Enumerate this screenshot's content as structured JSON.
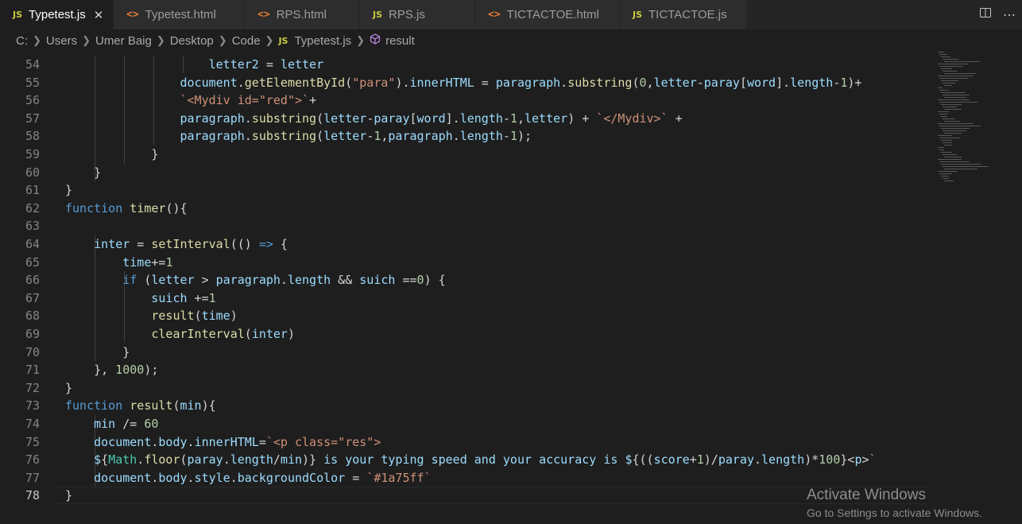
{
  "tabs": [
    {
      "label": "Typetest.js",
      "icon": "js-file-icon",
      "active": true
    },
    {
      "label": "Typetest.html",
      "icon": "html-file-icon"
    },
    {
      "label": "RPS.html",
      "icon": "html-file-icon"
    },
    {
      "label": "RPS.js",
      "icon": "js-file-icon"
    },
    {
      "label": "TICTACTOE.html",
      "icon": "html-file-icon"
    },
    {
      "label": "TICTACTOE.js",
      "icon": "js-file-icon"
    }
  ],
  "breadcrumb": {
    "drive": "C:",
    "parts": [
      "Users",
      "Umer Baig",
      "Desktop",
      "Code"
    ],
    "file": "Typetest.js",
    "symbol": "result"
  },
  "editor": {
    "line_numbers": [
      "54",
      "55",
      "56",
      "57",
      "58",
      "59",
      "60",
      "61",
      "62",
      "63",
      "64",
      "65",
      "66",
      "67",
      "68",
      "69",
      "70",
      "71",
      "72",
      "73",
      "74",
      "75",
      "76",
      "77",
      "78"
    ],
    "current_line": "78",
    "code_lines": [
      "                    letter2 = letter",
      "                document.getElementById(\"para\").innerHTML = paragraph.substring(0,letter-paray[word].length-1)+",
      "                `<Mydiv id=\"red\">`+",
      "                paragraph.substring(letter-paray[word].length-1,letter) + `</Mydiv>` +",
      "                paragraph.substring(letter-1,paragraph.length-1);",
      "            }",
      "    }",
      "}",
      "function timer(){",
      "",
      "    inter = setInterval(() => {",
      "        time+=1",
      "        if (letter > paragraph.length && suich ==0) {",
      "            suich +=1",
      "            result(time)",
      "            clearInterval(inter)",
      "        }",
      "    }, 1000);",
      "}",
      "function result(min){",
      "    min /= 60",
      "    document.body.innerHTML=`<p class=\"res\">",
      "    ${Math.floor(paray.length/min)} is your typing speed and your accuracy is ${((score+1)/paray.length)*100}<p>`",
      "    document.body.style.backgroundColor = `#1a75ff`",
      "}"
    ]
  },
  "watermark": {
    "title": "Activate Windows",
    "subtitle": "Go to Settings to activate Windows."
  },
  "colors": {
    "background": "#1e1e1e",
    "keyword": "#569cd6",
    "function": "#dcdcaa",
    "variable": "#9cdcfe",
    "string": "#ce9178",
    "number": "#b5cea8",
    "js_icon": "#cbcb41",
    "html_icon": "#e37933"
  }
}
